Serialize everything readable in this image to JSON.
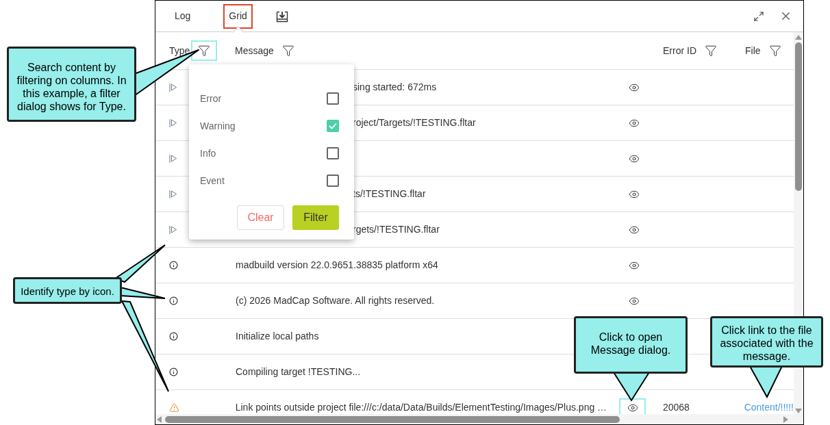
{
  "tabs": [
    {
      "label": "Log",
      "selected": false
    },
    {
      "label": "Grid",
      "selected": true
    }
  ],
  "columns": [
    {
      "label": "Type",
      "highlighted": true
    },
    {
      "label": "Message",
      "highlighted": false
    },
    {
      "label": "Error ID",
      "highlighted": false
    },
    {
      "label": "File",
      "highlighted": false
    }
  ],
  "rows": [
    {
      "kind": "event",
      "message": "sing started: 672ms",
      "covered": true,
      "view": true,
      "view_highlighted": false
    },
    {
      "kind": "event",
      "message": "roject/Targets/!TESTING.fltar",
      "covered": true,
      "view": true,
      "view_highlighted": false
    },
    {
      "kind": "event",
      "covered": true,
      "view": true,
      "view_highlighted": false
    },
    {
      "kind": "event",
      "message": "ts/!TESTING.fltar",
      "covered": true,
      "view": true,
      "view_highlighted": false
    },
    {
      "kind": "event",
      "message": "rgets/!TESTING.fltar",
      "covered": true,
      "view": true,
      "view_highlighted": false
    },
    {
      "kind": "info",
      "message": "madbuild version 22.0.9651.38835 platform x64",
      "covered": false,
      "view": true,
      "view_highlighted": false
    },
    {
      "kind": "info",
      "message": "(c) 2026 MadCap Software. All rights reserved.",
      "covered": false,
      "view": true,
      "view_highlighted": false
    },
    {
      "kind": "info",
      "message": "Initialize local paths",
      "covered": false
    },
    {
      "kind": "info",
      "message": "Compiling target !TESTING...",
      "covered": false
    },
    {
      "kind": "warning",
      "message": "Link points outside project file:///c:/data/Data/Builds/ElementTesting/Images/Plus.png …",
      "covered": false,
      "view": true,
      "view_highlighted": true,
      "error_id": "20068",
      "file": "Content/!!!!!"
    }
  ],
  "filter_popup": {
    "options": [
      {
        "label": "Error",
        "checked": false
      },
      {
        "label": "Warning",
        "checked": true
      },
      {
        "label": "Info",
        "checked": false
      },
      {
        "label": "Event",
        "checked": false
      }
    ],
    "clear": "Clear",
    "filter": "Filter"
  },
  "callouts": [
    {
      "text": "Search content by filtering on columns. In this example, a filter dialog shows for Type."
    },
    {
      "text": "Identify type by icon."
    },
    {
      "text": "Click to open Message dialog."
    },
    {
      "text": "Click link to the file associated with the message."
    }
  ]
}
